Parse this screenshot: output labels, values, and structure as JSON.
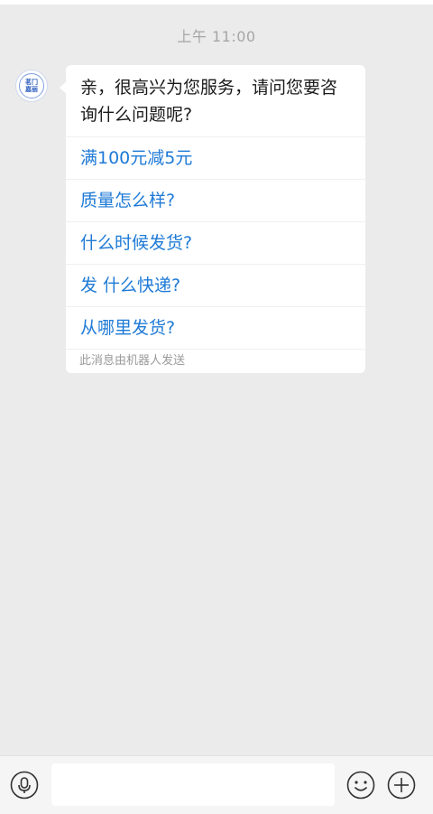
{
  "chat": {
    "timestamp": "上午 11:00",
    "avatar": {
      "line1": "茗门",
      "line2": "嘉丽"
    },
    "message": {
      "greeting": "亲，很高兴为您服务，请问您要咨询什么问题呢?",
      "options": [
        "满100元减5元",
        "质量怎么样?",
        "什么时候发货?",
        "发 什么快递?",
        "从哪里发货?"
      ],
      "bot_note": "此消息由机器人发送"
    }
  },
  "input_bar": {
    "text_value": "",
    "icons": {
      "voice": "microphone-icon",
      "emoji": "smiley-icon",
      "more": "plus-icon"
    }
  }
}
